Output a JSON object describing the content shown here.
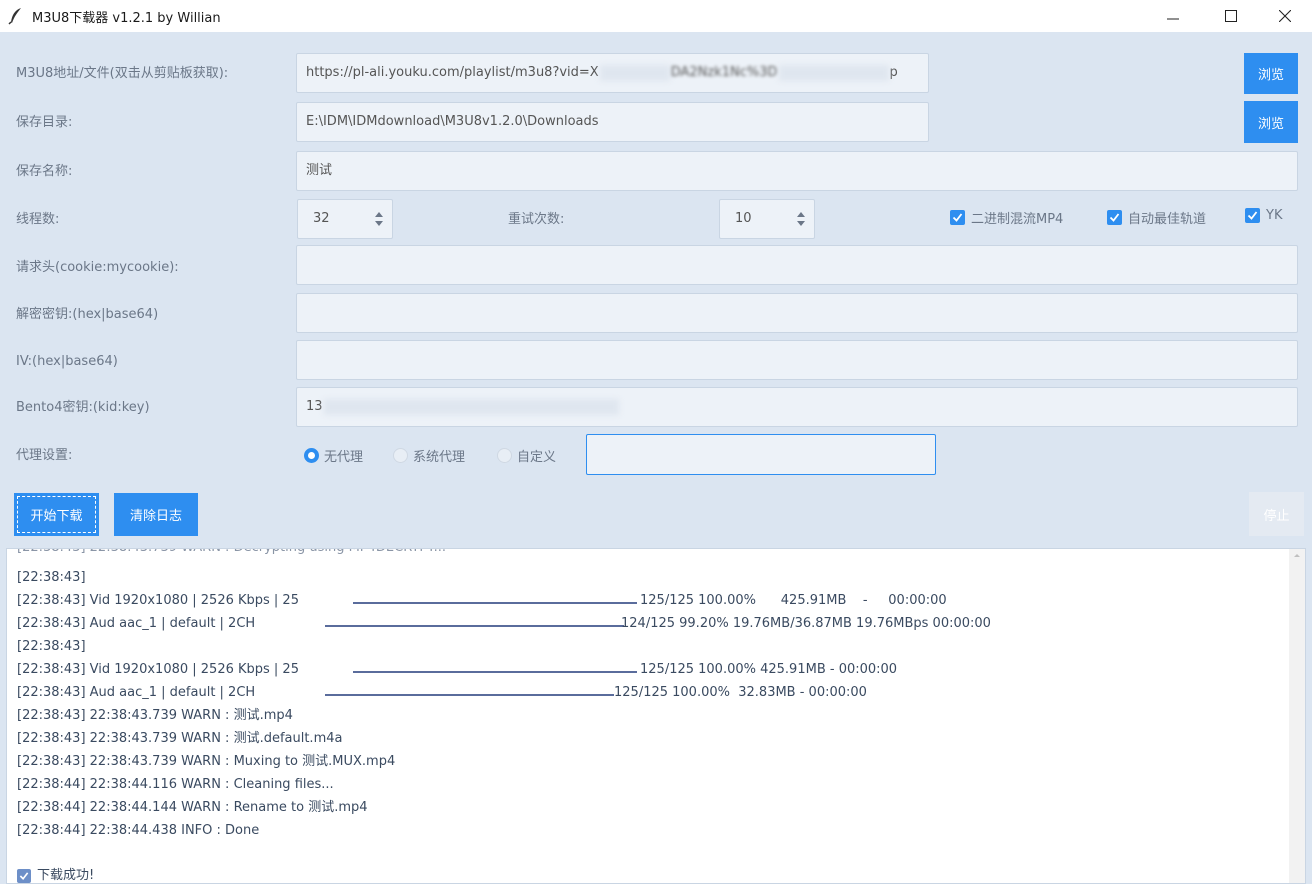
{
  "window": {
    "title": "M3U8下载器 v1.2.1 by Willian"
  },
  "form": {
    "url_label": "M3U8地址/文件(双击从剪贴板获取):",
    "url_value_prefix": "https://pl-ali.youku.com/playlist/m3u8?vid=X",
    "url_value_mid": "DA2Nzk1Nc%3D",
    "url_value_end": "p",
    "browse_label": "浏览",
    "save_dir_label": "保存目录:",
    "save_dir_value": "E:\\IDM\\IDMdownload\\M3U8v1.2.0\\Downloads",
    "save_name_label": "保存名称:",
    "save_name_value": "测试",
    "threads_label": "线程数:",
    "threads_value": "32",
    "retry_label": "重试次数:",
    "retry_value": "10",
    "checkbox_binary_merge": "二进制混流MP4",
    "checkbox_auto_track": "自动最佳轨道",
    "checkbox_yk": "YK",
    "headers_label": "请求头(cookie:mycookie):",
    "key_label": "解密密钥:(hex|base64)",
    "iv_label": "IV:(hex|base64)",
    "bento_label": "Bento4密钥:(kid:key)",
    "bento_value_prefix": "13",
    "proxy_label": "代理设置:",
    "proxy_none": "无代理",
    "proxy_system": "系统代理",
    "proxy_custom": "自定义"
  },
  "actions": {
    "start": "开始下载",
    "clear_log": "清除日志",
    "stop": "停止"
  },
  "log": {
    "lines": [
      "[22:38:43]",
      "[22:38:43] Vid 1920x1080 | 2526 Kbps | 25",
      "[22:38:43] Aud aac_1 | default | 2CH",
      "[22:38:43]",
      "[22:38:43] Vid 1920x1080 | 2526 Kbps | 25",
      "[22:38:43] Aud aac_1 | default | 2CH",
      "[22:38:43] 22:38:43.739 WARN : 测试.mp4",
      "[22:38:43] 22:38:43.739 WARN : 测试.default.m4a",
      "[22:38:43] 22:38:43.739 WARN : Muxing to 测试.MUX.mp4",
      "[22:38:44] 22:38:44.116 WARN : Cleaning files...",
      "[22:38:44] 22:38:44.144 WARN : Rename to 测试.mp4",
      "[22:38:44] 22:38:44.438 INFO : Done"
    ],
    "progress": [
      "125/125 100.00%      425.91MB    -     00:00:00",
      "124/125 99.20% 19.76MB/36.87MB 19.76MBps 00:00:00",
      "125/125 100.00% 425.91MB - 00:00:00",
      "125/125 100.00%  32.83MB - 00:00:00"
    ],
    "success": "下载成功!"
  },
  "colors": {
    "accent": "#2e8ef0",
    "background": "#dbe5f1"
  }
}
